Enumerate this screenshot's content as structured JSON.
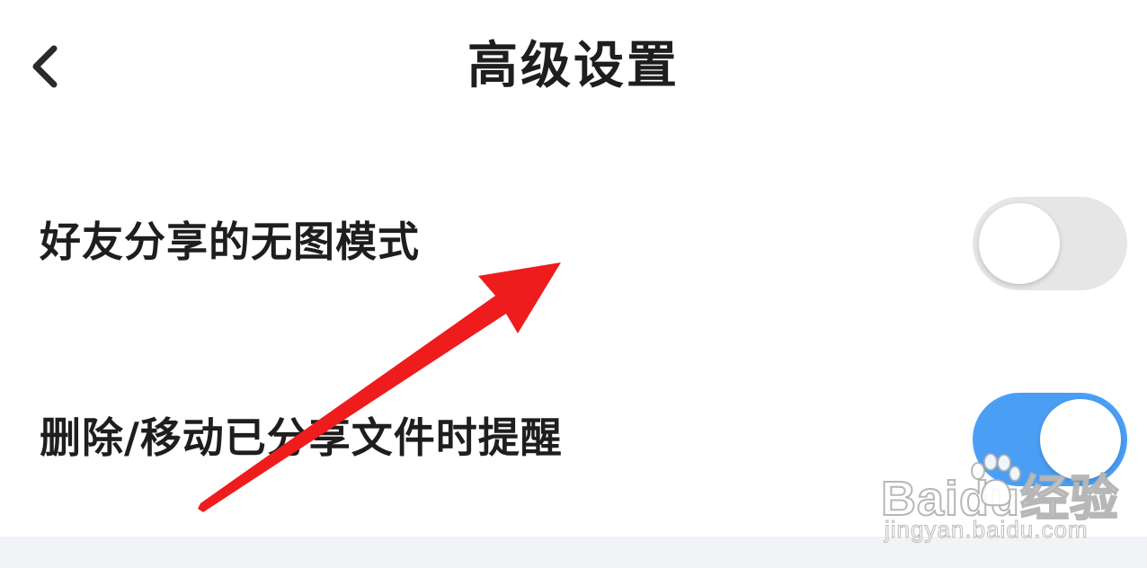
{
  "header": {
    "title": "高级设置",
    "back_icon": "chevron-left-icon"
  },
  "settings": [
    {
      "label": "好友分享的无图模式",
      "enabled": false
    },
    {
      "label": "删除/移动已分享文件时提醒",
      "enabled": true
    }
  ],
  "colors": {
    "toggle_on": "#4a9ff5",
    "toggle_off": "#e6e6e6",
    "annotation_arrow": "#ee1c1c",
    "bottom_band": "#f2f3f7"
  },
  "watermark": {
    "brand": "Baidu经验",
    "url": "jingyan.baidu.com"
  }
}
